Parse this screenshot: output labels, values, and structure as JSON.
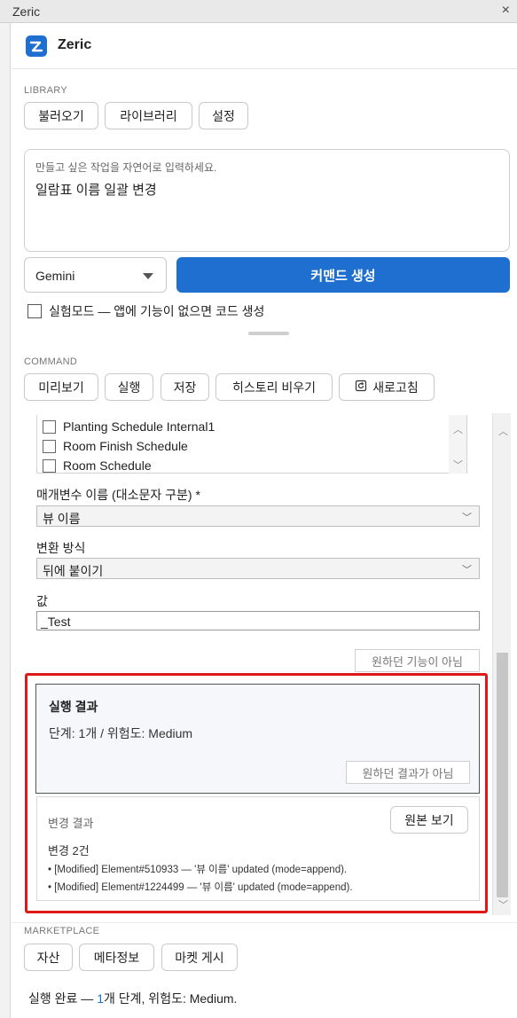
{
  "window": {
    "title": "Zeric",
    "close_glyph": "×"
  },
  "app": {
    "name": "Zeric",
    "logo_icon": "zeric-logo-icon"
  },
  "library": {
    "label": "LIBRARY",
    "buttons": [
      "불러오기",
      "라이브러리",
      "설정"
    ]
  },
  "prompt": {
    "placeholder": "만들고 싶은 작업을 자연어로 입력하세요.",
    "value": "일람표 이름 일괄 변경"
  },
  "model": {
    "selected": "Gemini"
  },
  "generate_button": "커맨드 생성",
  "experimental": {
    "label": "실험모드 — 앱에 기능이 없으면 코드 생성",
    "checked": false
  },
  "command": {
    "label": "COMMAND",
    "buttons": [
      "미리보기",
      "실행",
      "저장",
      "히스토리 비우기"
    ],
    "refresh_button": "새로고침",
    "refresh_icon": "refresh-icon"
  },
  "schedule_list": [
    "Planting Schedule Internal1",
    "Room Finish Schedule",
    "Room Schedule"
  ],
  "params": {
    "param_label": "매개변수 이름 (대소문자 구분) *",
    "param_value": "뷰 이름",
    "mode_label": "변환 방식",
    "mode_value": "뒤에 붙이기",
    "value_label": "값",
    "value_value": "_Test",
    "not_wanted_feature": "원하던 기능이 아님"
  },
  "result": {
    "title": "실행 결과",
    "summary": "단계: 1개 / 위험도: Medium",
    "not_wanted_result": "원하던 결과가 아님"
  },
  "changes": {
    "title": "변경 결과",
    "view_original": "원본 보기",
    "count": "변경 2건",
    "lines": [
      "• [Modified] Element#510933 — '뷰 이름' updated (mode=append).",
      "• [Modified] Element#1224499 — '뷰 이름' updated (mode=append)."
    ]
  },
  "marketplace": {
    "label": "MARKETPLACE",
    "buttons": [
      "자산",
      "메타정보",
      "마켓 게시"
    ]
  },
  "status": {
    "prefix": "실행 완료 — ",
    "count": "1",
    "suffix": "개 단계, 위험도: Medium."
  },
  "colors": {
    "accent": "#1e6fd0",
    "highlight": "#e01818"
  }
}
